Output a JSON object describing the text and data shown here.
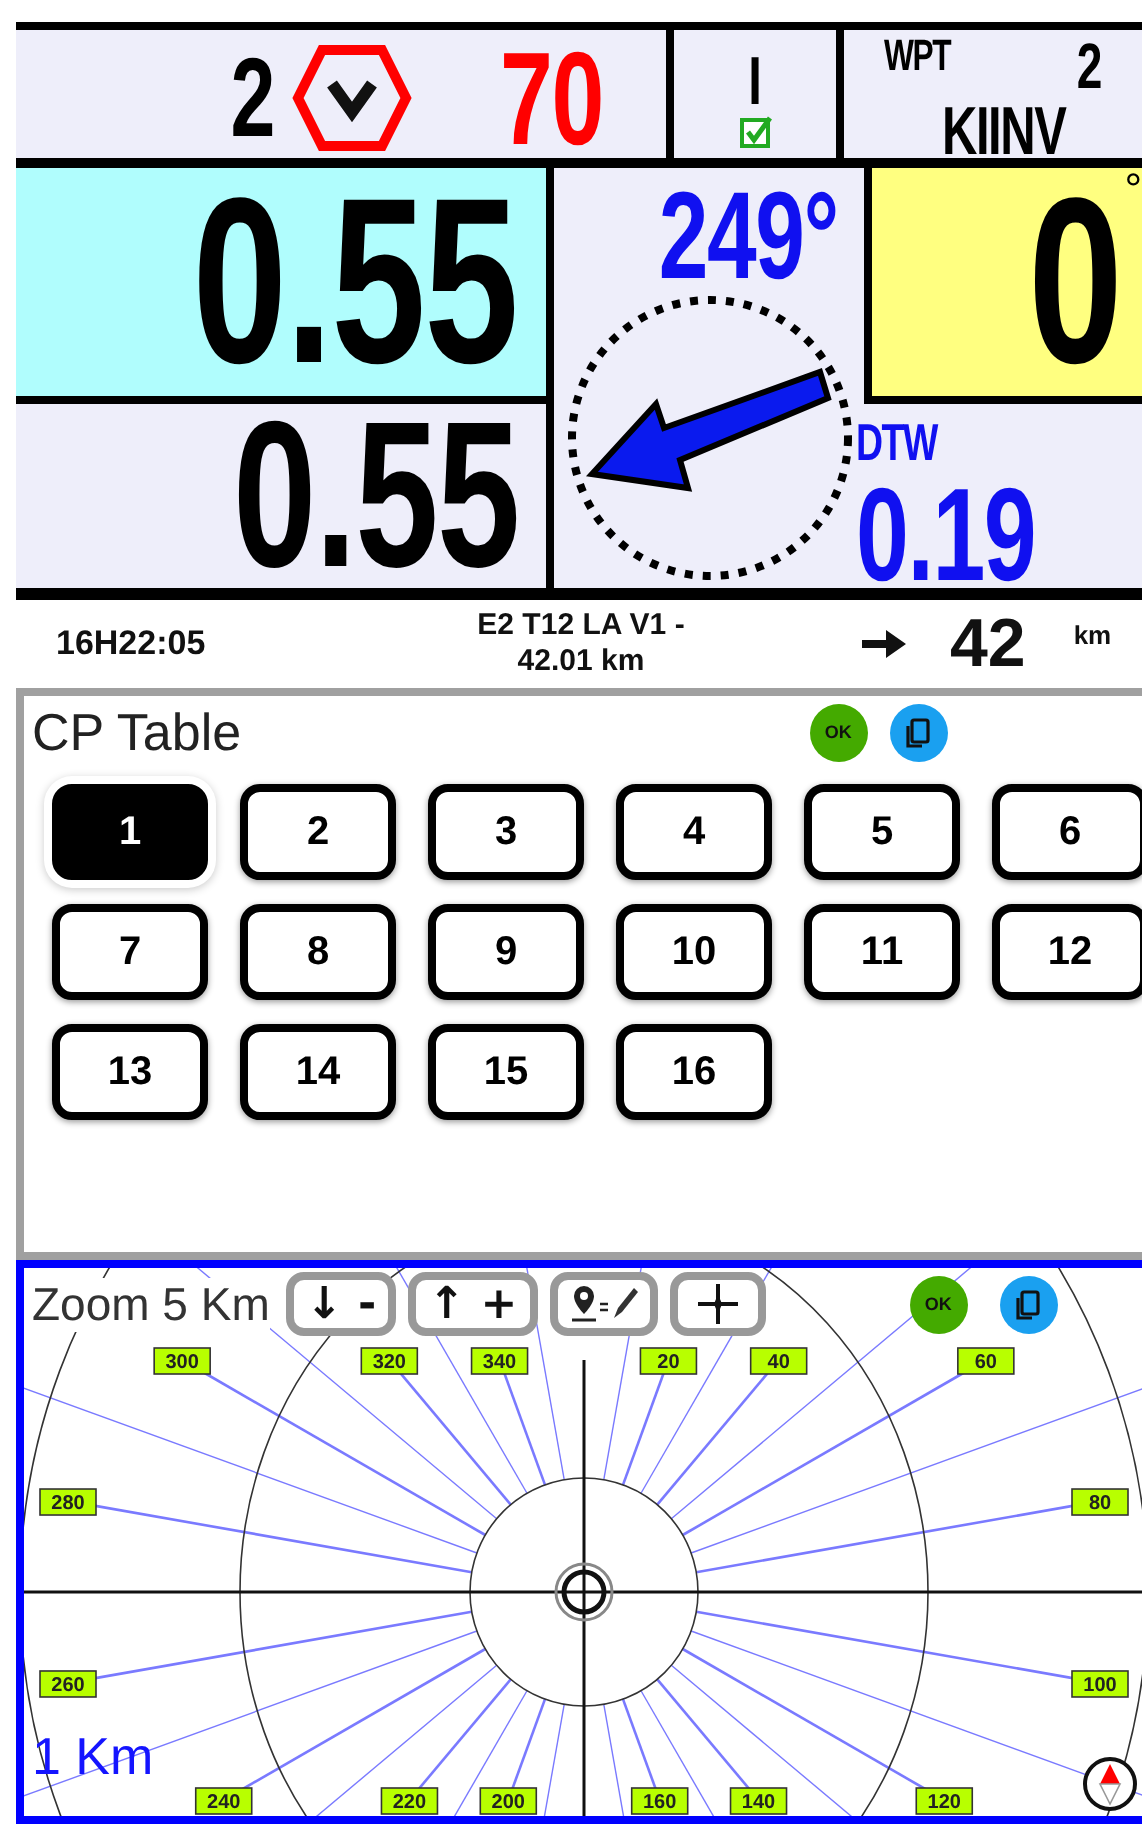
{
  "top_bar": {
    "count": "2",
    "speed_limit": "70",
    "flag_label": "I",
    "flag_checked": true,
    "wpt_label": "WPT",
    "wpt_number": "2",
    "wpt_name": "KIINV"
  },
  "gauges": {
    "value_1": "0.55",
    "value_2": "0.55",
    "heading": "249°",
    "value_3": "0",
    "value_3_unit": "°",
    "dtw_label": "DTW",
    "dtw_value": "0.19"
  },
  "info_bar": {
    "time": "16H22:05",
    "route_lines": [
      "E2 T12 LA V1 -",
      "42.01 km"
    ],
    "distance": "42",
    "distance_unit": "km"
  },
  "cp_table": {
    "title": "CP Table",
    "ok_label": "OK",
    "checkpoints": [
      {
        "label": "1",
        "selected": true
      },
      {
        "label": "2",
        "selected": false
      },
      {
        "label": "3",
        "selected": false
      },
      {
        "label": "4",
        "selected": false
      },
      {
        "label": "5",
        "selected": false
      },
      {
        "label": "6",
        "selected": false
      },
      {
        "label": "7",
        "selected": false
      },
      {
        "label": "8",
        "selected": false
      },
      {
        "label": "9",
        "selected": false
      },
      {
        "label": "10",
        "selected": false
      },
      {
        "label": "11",
        "selected": false
      },
      {
        "label": "12",
        "selected": false
      },
      {
        "label": "13",
        "selected": false
      },
      {
        "label": "14",
        "selected": false
      },
      {
        "label": "15",
        "selected": false
      },
      {
        "label": "16",
        "selected": false
      }
    ]
  },
  "map": {
    "zoom_label": "Zoom 5 Km",
    "zoom_out": "↓ -",
    "zoom_in": "↑ +",
    "ok_label": "OK",
    "scale_label": "1 Km",
    "bearings": [
      "300",
      "320",
      "340",
      "20",
      "40",
      "60",
      "280",
      "80",
      "260",
      "100",
      "240",
      "220",
      "200",
      "160",
      "140",
      "120"
    ]
  }
}
